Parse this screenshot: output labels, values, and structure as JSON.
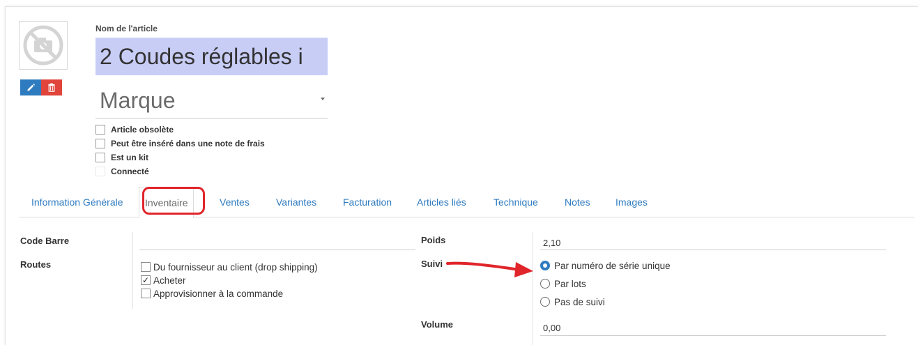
{
  "product": {
    "name_label": "Nom de l'article",
    "name_value": "2 Coudes réglables i",
    "brand_value": "Marque",
    "flags": [
      {
        "label": "Article obsolète",
        "checked": false
      },
      {
        "label": "Peut être inséré dans une note de frais",
        "checked": false
      },
      {
        "label": "Est un kit",
        "checked": false
      },
      {
        "label": "Connecté",
        "checked": false
      }
    ]
  },
  "image": {
    "icon": "camera-off-icon"
  },
  "tabs": [
    {
      "label": "Information Générale",
      "active": false
    },
    {
      "label": "Inventaire",
      "active": true
    },
    {
      "label": "Ventes",
      "active": false
    },
    {
      "label": "Variantes",
      "active": false
    },
    {
      "label": "Facturation",
      "active": false
    },
    {
      "label": "Articles liés",
      "active": false
    },
    {
      "label": "Technique",
      "active": false
    },
    {
      "label": "Notes",
      "active": false
    },
    {
      "label": "Images",
      "active": false
    }
  ],
  "inventory": {
    "barcode_label": "Code Barre",
    "barcode_value": "",
    "routes_label": "Routes",
    "routes": [
      {
        "label": "Du fournisseur au client (drop shipping)",
        "checked": false
      },
      {
        "label": "Acheter",
        "checked": true
      },
      {
        "label": "Approvisionner à la commande",
        "checked": false
      }
    ],
    "weight_label": "Poids",
    "weight_value": "2,10",
    "tracking_label": "Suivi",
    "tracking_options": [
      {
        "label": "Par numéro de série unique",
        "selected": true
      },
      {
        "label": "Par lots",
        "selected": false
      },
      {
        "label": "Pas de suivi",
        "selected": false
      }
    ],
    "volume_label": "Volume",
    "volume_value": "0,00"
  },
  "colors": {
    "accent": "#2f7bbf",
    "name_highlight": "#c8cdf6",
    "annotation": "#e0252b",
    "delete": "#e0443a"
  }
}
